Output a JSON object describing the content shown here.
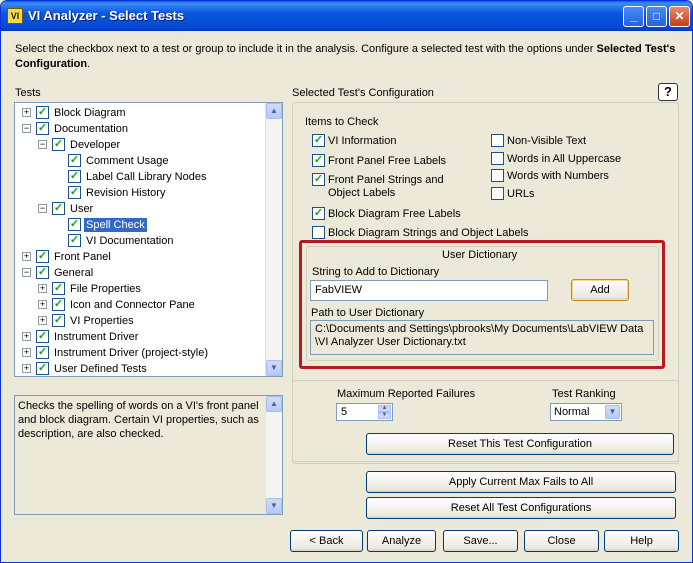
{
  "window": {
    "title": "VI Analyzer - Select Tests",
    "icon": "VI"
  },
  "titlebar_buttons": {
    "minimize": "_",
    "maximize": "□",
    "close": "✕"
  },
  "intro": {
    "text": "Select the checkbox next to a test or group to include it in the analysis.  Configure a selected test with the options under ",
    "bold": "Selected Test's Configuration",
    "end": "."
  },
  "tests_label": "Tests",
  "tree": [
    {
      "label": "Block Diagram",
      "level": 0,
      "expander": "+",
      "checked": true
    },
    {
      "label": "Documentation",
      "level": 0,
      "expander": "−",
      "checked": true
    },
    {
      "label": "Developer",
      "level": 1,
      "expander": "−",
      "checked": true
    },
    {
      "label": "Comment Usage",
      "level": 2,
      "expander": "",
      "checked": true
    },
    {
      "label": "Label Call Library Nodes",
      "level": 2,
      "expander": "",
      "checked": true
    },
    {
      "label": "Revision History",
      "level": 2,
      "expander": "",
      "checked": true
    },
    {
      "label": "User",
      "level": 1,
      "expander": "−",
      "checked": true
    },
    {
      "label": "Spell Check",
      "level": 2,
      "expander": "",
      "checked": true,
      "selected": true
    },
    {
      "label": "VI Documentation",
      "level": 2,
      "expander": "",
      "checked": true
    },
    {
      "label": "Front Panel",
      "level": 0,
      "expander": "+",
      "checked": true
    },
    {
      "label": "General",
      "level": 0,
      "expander": "−",
      "checked": true
    },
    {
      "label": "File Properties",
      "level": 1,
      "expander": "+",
      "checked": true
    },
    {
      "label": "Icon and Connector Pane",
      "level": 1,
      "expander": "+",
      "checked": true
    },
    {
      "label": "VI Properties",
      "level": 1,
      "expander": "+",
      "checked": true
    },
    {
      "label": "Instrument Driver",
      "level": 0,
      "expander": "+",
      "checked": true
    },
    {
      "label": "Instrument Driver (project-style)",
      "level": 0,
      "expander": "+",
      "checked": true
    },
    {
      "label": "User Defined Tests",
      "level": 0,
      "expander": "+",
      "checked": true
    }
  ],
  "description": "Checks the spelling of words on a VI's front panel and block diagram.  Certain VI properties, such as description, are also checked.",
  "config": {
    "heading": "Selected Test's Configuration",
    "help_label": "?",
    "items_heading": "Items to Check",
    "items": [
      {
        "label": "VI Information",
        "checked": true
      },
      {
        "label": "Front Panel Free Labels",
        "checked": true
      },
      {
        "label": "Front Panel Strings and\nObject Labels",
        "checked": true
      },
      {
        "label": "Block Diagram Free Labels",
        "checked": true
      },
      {
        "label": "Block Diagram Strings and Object Labels",
        "checked": false
      },
      {
        "label": "Non-Visible Text",
        "checked": false
      },
      {
        "label": "Words in All Uppercase",
        "checked": false
      },
      {
        "label": "Words with Numbers",
        "checked": false
      },
      {
        "label": "URLs",
        "checked": false
      }
    ],
    "dictionary": {
      "heading": "User Dictionary",
      "string_label": "String to Add to Dictionary",
      "string_value": "FabVIEW",
      "add_button": "Add",
      "path_label": "Path to User Dictionary",
      "path_value": "C:\\Documents and Settings\\pbrooks\\My Documents\\LabVIEW Data\\VI Analyzer User Dictionary.txt"
    },
    "max_failures_label": "Maximum Reported Failures",
    "max_failures_value": "5",
    "ranking_label": "Test Ranking",
    "ranking_value": "Normal",
    "reset_button": "Reset This Test Configuration"
  },
  "apply_button": "Apply Current Max Fails to All",
  "reset_all_button": "Reset All Test Configurations",
  "footer": {
    "back": "< Back",
    "analyze": "Analyze",
    "save": "Save...",
    "close": "Close",
    "help": "Help"
  },
  "colors": {
    "selection": "#316ac5",
    "highlight_box": "#b8191c",
    "check": "#21a121"
  }
}
